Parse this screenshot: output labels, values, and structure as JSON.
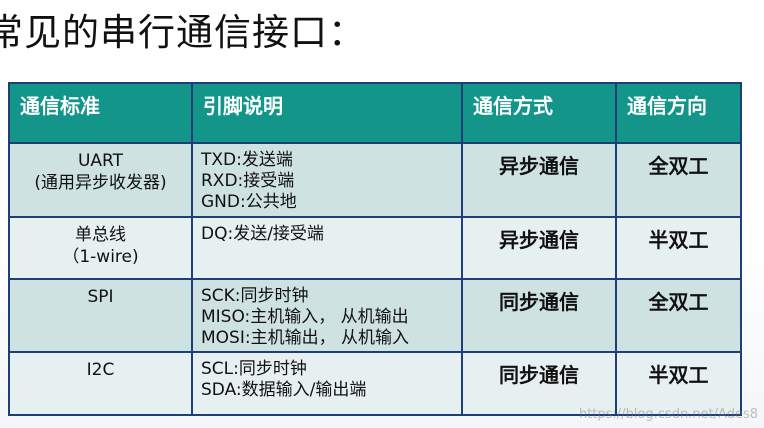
{
  "title": "常见的串行通信接口：",
  "table": {
    "headers": [
      "通信标准",
      "引脚说明",
      "通信方式",
      "通信方向"
    ],
    "rows": [
      {
        "standard": [
          "UART",
          "(通用异步收发器)"
        ],
        "pins": [
          "TXD:发送端",
          "RXD:接受端",
          "GND:公共地"
        ],
        "mode": "异步通信",
        "direction": "全双工"
      },
      {
        "standard": [
          "单总线",
          "（1-wire)"
        ],
        "pins": [
          "DQ:发送/接受端"
        ],
        "mode": "异步通信",
        "direction": "半双工"
      },
      {
        "standard": [
          "SPI"
        ],
        "pins": [
          "SCK:同步时钟",
          "MISO:主机输入， 从机输出",
          "MOSI:主机输出， 从机输入"
        ],
        "mode": "同步通信",
        "direction": "全双工"
      },
      {
        "standard": [
          "I2C"
        ],
        "pins": [
          "SCL:同步时钟",
          "SDA:数据输入/输出端"
        ],
        "mode": "同步通信",
        "direction": "半双工"
      }
    ]
  },
  "watermark": "https://blog.csdn.net/Ades8"
}
